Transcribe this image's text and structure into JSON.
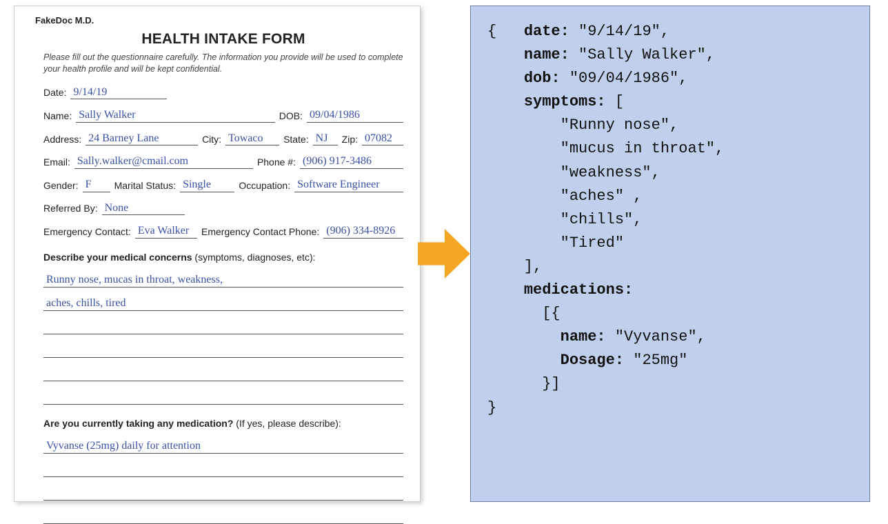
{
  "form": {
    "doctor": "FakeDoc M.D.",
    "title": "HEALTH INTAKE FORM",
    "instructions": "Please fill out the questionnaire carefully. The information you provide will be used to complete your health profile and will be kept confidential.",
    "labels": {
      "date": "Date:",
      "name": "Name:",
      "dob": "DOB:",
      "address": "Address:",
      "city": "City:",
      "state": "State:",
      "zip": "Zip:",
      "email": "Email:",
      "phone": "Phone #:",
      "gender": "Gender:",
      "marital": "Marital Status:",
      "occupation": "Occupation:",
      "referred": "Referred By:",
      "econtact": "Emergency Contact:",
      "ephone": "Emergency Contact Phone:",
      "concerns_hdr": "Describe your medical concerns",
      "concerns_paren": " (symptoms, diagnoses, etc):",
      "meds_hdr": "Are you currently taking any medication?",
      "meds_paren": " (If yes, please describe):"
    },
    "values": {
      "date": "9/14/19",
      "name": "Sally Walker",
      "dob": "09/04/1986",
      "address": "24 Barney Lane",
      "city": "Towaco",
      "state": "NJ",
      "zip": "07082",
      "email": "Sally.walker@cmail.com",
      "phone": "(906) 917-3486",
      "gender": "F",
      "marital": "Single",
      "occupation": "Software Engineer",
      "referred": "None",
      "econtact": "Eva Walker",
      "ephone": "(906) 334-8926",
      "concerns_line1": "Runny nose, mucas in throat, weakness,",
      "concerns_line2": "aches, chills, tired",
      "meds_line1": "Vyvanse (25mg) daily for attention"
    }
  },
  "json_output": {
    "l1": "{   ",
    "k_date": "date:",
    "v_date": " \"9/14/19\",",
    "k_name": "name:",
    "v_name": " \"Sally Walker\",",
    "k_dob": "dob:",
    "v_dob": " \"09/04/1986\",",
    "k_sym": "symptoms:",
    "v_sym": " [",
    "s1": "        \"Runny nose\",",
    "s2": "        \"mucus in throat\",",
    "s3": "        \"weakness\",",
    "s4": "        \"aches\" ,",
    "s5": "        \"chills\",",
    "s6": "        \"Tired\"",
    "sym_close": "    ],",
    "k_med": "medications:",
    "med_open": "      [{",
    "k_mname": "name:",
    "v_mname": " \"Vyvanse\",",
    "k_dose": "Dosage:",
    "v_dose": " \"25mg\"",
    "med_close": "      }]",
    "l_end": "}"
  }
}
